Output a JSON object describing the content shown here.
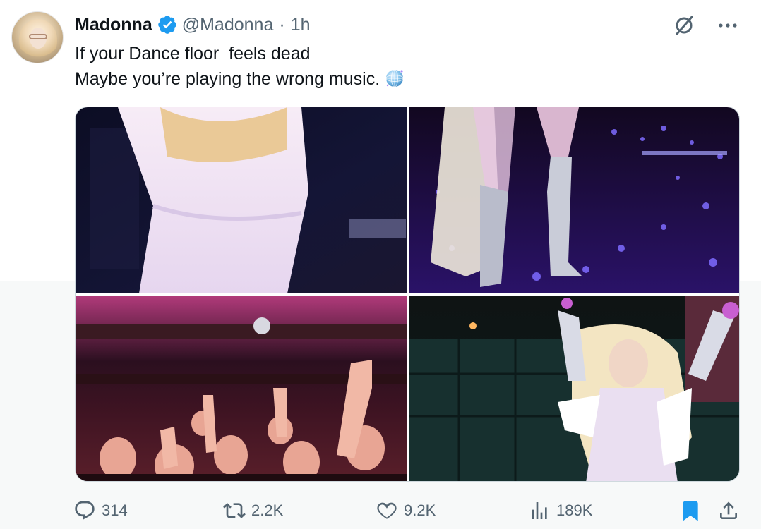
{
  "author": {
    "name": "Madonna",
    "handle": "@Madonna",
    "separator": "·",
    "time": "1h",
    "verified_color": "#1d9bf0"
  },
  "tweet": {
    "line1": "If your Dance floor  feels dead",
    "line2": "Maybe you’re playing the wrong music."
  },
  "icons": {
    "verified": "verified-badge-icon",
    "grok": "grok-icon",
    "more": "more-icon",
    "globe": "disco-globe-emoji",
    "reply": "reply-icon",
    "retweet": "retweet-icon",
    "like": "heart-icon",
    "views": "analytics-icon",
    "bookmark": "bookmark-icon",
    "share": "share-icon"
  },
  "stats": {
    "replies": "314",
    "retweets": "2.2K",
    "likes": "9.2K",
    "views": "189K"
  },
  "colors": {
    "text": "#0f1419",
    "muted": "#536471",
    "accent": "#1d9bf0",
    "bookmark_active": "#1d9bf0"
  }
}
